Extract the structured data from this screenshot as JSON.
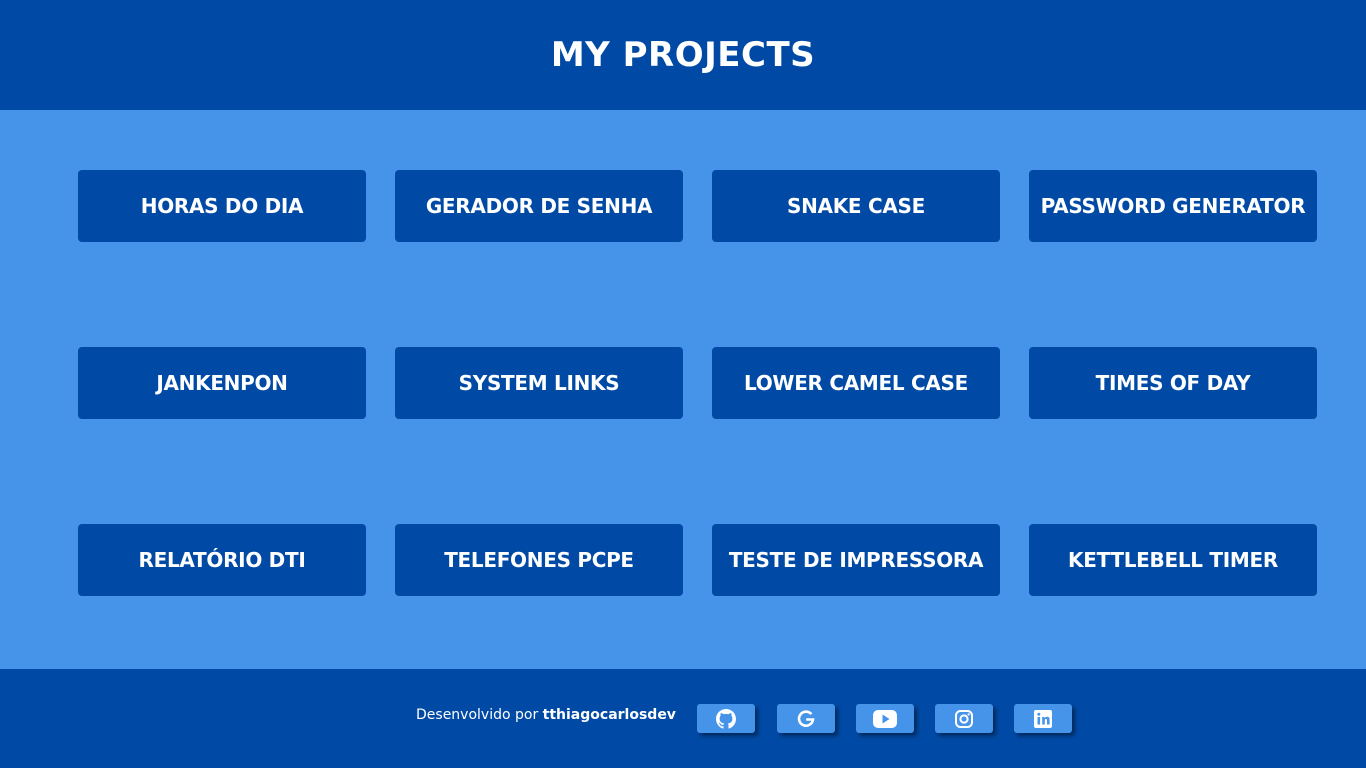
{
  "header": {
    "title": "MY PROJECTS"
  },
  "projects": [
    {
      "label": "HORAS DO DIA"
    },
    {
      "label": "GERADOR DE SENHA"
    },
    {
      "label": "SNAKE CASE"
    },
    {
      "label": "PASSWORD GENERATOR"
    },
    {
      "label": "JANKENPON"
    },
    {
      "label": "SYSTEM LINKS"
    },
    {
      "label": "LOWER CAMEL CASE"
    },
    {
      "label": "TIMES OF DAY"
    },
    {
      "label": "RELATÓRIO DTI"
    },
    {
      "label": "TELEFONES PCPE"
    },
    {
      "label": "TESTE DE IMPRESSORA"
    },
    {
      "label": "KETTLEBELL TIMER"
    }
  ],
  "footer": {
    "credit_prefix": "Desenvolvido por ",
    "author": "tthiagocarlosdev",
    "social": [
      {
        "icon": "github-icon"
      },
      {
        "icon": "google-icon"
      },
      {
        "icon": "youtube-icon"
      },
      {
        "icon": "instagram-icon"
      },
      {
        "icon": "linkedin-icon"
      }
    ]
  },
  "colors": {
    "primary": "#004aa6",
    "background": "#4693ea",
    "text": "#ffffff"
  }
}
